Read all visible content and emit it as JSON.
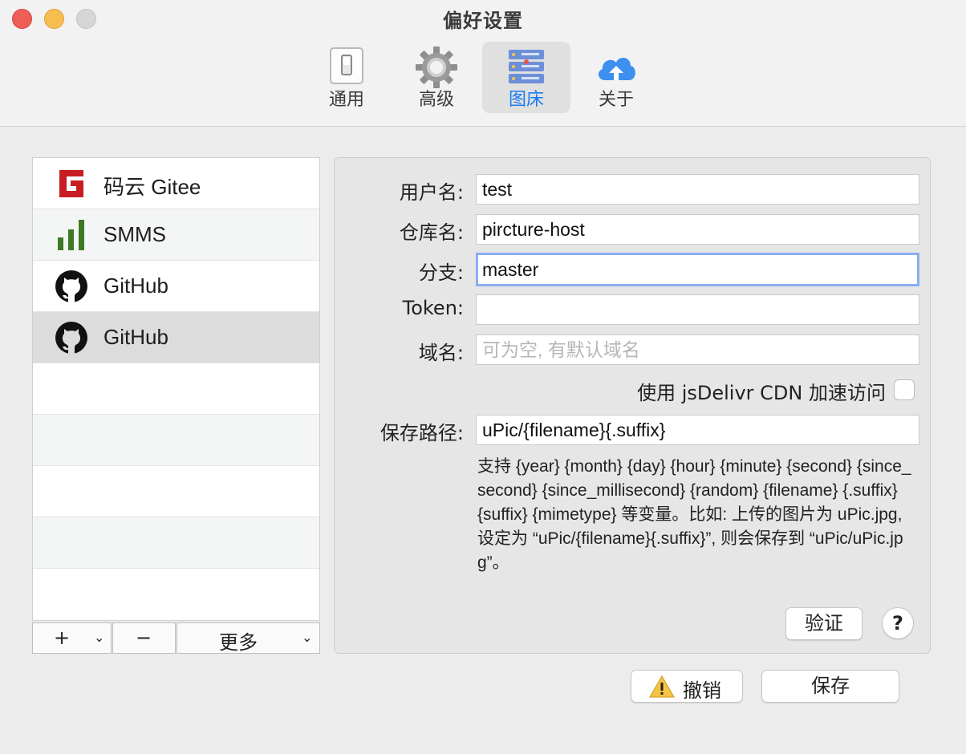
{
  "window": {
    "title": "偏好设置"
  },
  "tabs": [
    {
      "label": "通用",
      "icon": "switch-icon",
      "active": false
    },
    {
      "label": "高级",
      "icon": "gear-icon",
      "active": false
    },
    {
      "label": "图床",
      "icon": "server-icon",
      "active": true
    },
    {
      "label": "关于",
      "icon": "cloud-upload-icon",
      "active": false
    }
  ],
  "sidebar": {
    "items": [
      {
        "label": "码云 Gitee",
        "icon": "gitee-icon",
        "selected": false
      },
      {
        "label": "SMMS",
        "icon": "bar-chart-icon",
        "selected": false
      },
      {
        "label": "GitHub",
        "icon": "github-icon",
        "selected": false
      },
      {
        "label": "GitHub",
        "icon": "github-icon",
        "selected": true
      }
    ],
    "footer": {
      "add_label": "+",
      "remove_label": "−",
      "more_label": "更多"
    }
  },
  "form": {
    "username_label": "用户名:",
    "username_value": "test",
    "repo_label": "仓库名:",
    "repo_value": "pircture-host",
    "branch_label": "分支:",
    "branch_value": "master",
    "token_label": "Token:",
    "token_value": "",
    "domain_label": "域名:",
    "domain_value": "",
    "domain_placeholder": "可为空, 有默认域名",
    "cdn_label": "使用 jsDelivr CDN 加速访问",
    "cdn_checked": false,
    "path_label": "保存路径:",
    "path_value": "uPic/{filename}{.suffix}",
    "help_text": "支持 {year} {month} {day} {hour} {minute} {second} {since_second} {since_millisecond} {random} {filename} {.suffix} {suffix} {mimetype} 等变量。比如: 上传的图片为 uPic.jpg, 设定为 “uPic/{filename}{.suffix}”, 则会保存到 “uPic/uPic.jpg”。",
    "verify_label": "验证",
    "help_button_label": "?"
  },
  "actions": {
    "cancel_label": "撤销",
    "save_label": "保存"
  }
}
